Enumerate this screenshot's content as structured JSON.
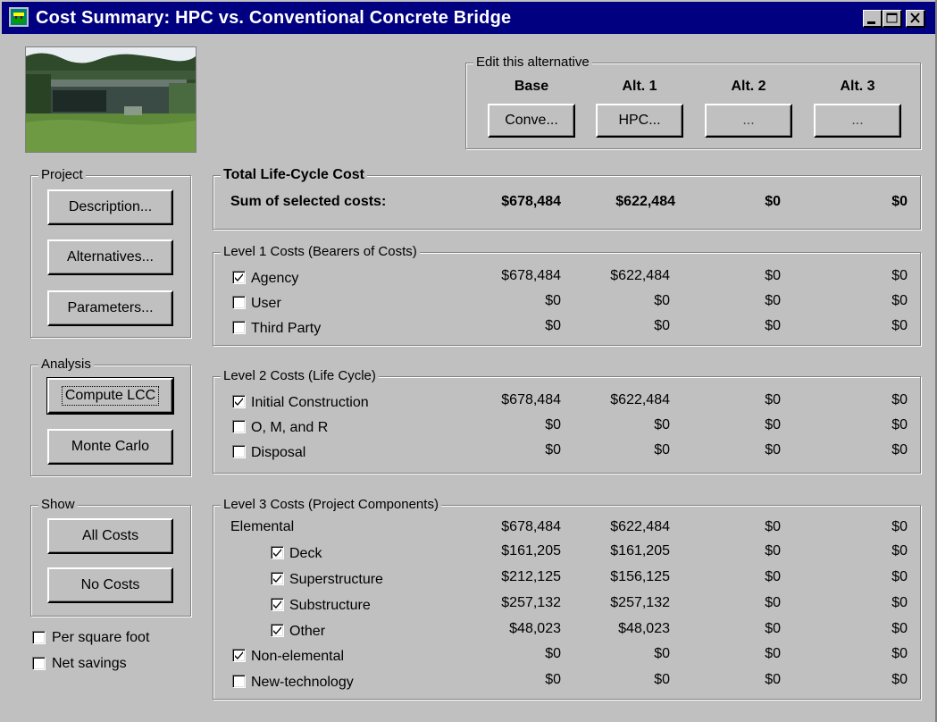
{
  "window": {
    "title": "Cost Summary: HPC vs. Conventional Concrete Bridge"
  },
  "alternatives_group": {
    "legend": "Edit this alternative",
    "headers": [
      "Base",
      "Alt. 1",
      "Alt. 2",
      "Alt. 3"
    ],
    "buttons": [
      "Conve...",
      "HPC...",
      "...",
      "..."
    ]
  },
  "project": {
    "legend": "Project",
    "description": "Description...",
    "alternatives": "Alternatives...",
    "parameters": "Parameters..."
  },
  "analysis": {
    "legend": "Analysis",
    "compute": "Compute LCC",
    "monte_carlo": "Monte Carlo"
  },
  "show": {
    "legend": "Show",
    "all_costs": "All Costs",
    "no_costs": "No Costs"
  },
  "options": {
    "per_square_foot": "Per square foot",
    "net_savings": "Net savings"
  },
  "total": {
    "legend": "Total Life-Cycle Cost",
    "label": "Sum of selected costs:",
    "values": [
      "$678,484",
      "$622,484",
      "$0",
      "$0"
    ]
  },
  "level1": {
    "legend": "Level 1 Costs (Bearers of Costs)",
    "rows": [
      {
        "label": "Agency",
        "checked": true,
        "values": [
          "$678,484",
          "$622,484",
          "$0",
          "$0"
        ]
      },
      {
        "label": "User",
        "checked": false,
        "values": [
          "$0",
          "$0",
          "$0",
          "$0"
        ]
      },
      {
        "label": "Third Party",
        "checked": false,
        "values": [
          "$0",
          "$0",
          "$0",
          "$0"
        ]
      }
    ]
  },
  "level2": {
    "legend": "Level 2 Costs (Life Cycle)",
    "rows": [
      {
        "label": "Initial Construction",
        "checked": true,
        "values": [
          "$678,484",
          "$622,484",
          "$0",
          "$0"
        ]
      },
      {
        "label": "O, M, and R",
        "checked": false,
        "values": [
          "$0",
          "$0",
          "$0",
          "$0"
        ]
      },
      {
        "label": "Disposal",
        "checked": false,
        "values": [
          "$0",
          "$0",
          "$0",
          "$0"
        ]
      }
    ]
  },
  "level3": {
    "legend": "Level 3 Costs (Project Components)",
    "elemental": {
      "label": "Elemental",
      "values": [
        "$678,484",
        "$622,484",
        "$0",
        "$0"
      ]
    },
    "sub_rows": [
      {
        "label": "Deck",
        "checked": true,
        "values": [
          "$161,205",
          "$161,205",
          "$0",
          "$0"
        ]
      },
      {
        "label": "Superstructure",
        "checked": true,
        "values": [
          "$212,125",
          "$156,125",
          "$0",
          "$0"
        ]
      },
      {
        "label": "Substructure",
        "checked": true,
        "values": [
          "$257,132",
          "$257,132",
          "$0",
          "$0"
        ]
      },
      {
        "label": "Other",
        "checked": true,
        "values": [
          "$48,023",
          "$48,023",
          "$0",
          "$0"
        ]
      }
    ],
    "rows": [
      {
        "label": "Non-elemental",
        "checked": true,
        "values": [
          "$0",
          "$0",
          "$0",
          "$0"
        ]
      },
      {
        "label": "New-technology",
        "checked": false,
        "values": [
          "$0",
          "$0",
          "$0",
          "$0"
        ]
      }
    ]
  }
}
